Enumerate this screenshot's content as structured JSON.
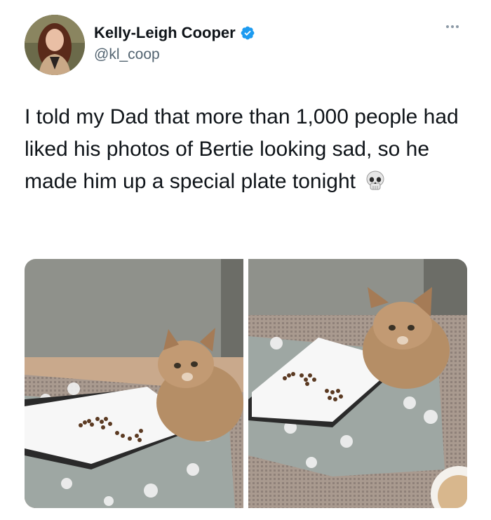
{
  "author": {
    "display_name": "Kelly-Leigh Cooper",
    "handle": "@kl_coop",
    "verified": true
  },
  "tweet": {
    "text": "I told my Dad that more than 1,000 people had liked his photos of Bertie looking sad, so he made him up a special plate tonight",
    "emoji": "💀"
  },
  "media": {
    "count": 2,
    "photos": [
      {
        "description_icon": "cat-photo-icon"
      },
      {
        "description_icon": "cat-photo-icon"
      }
    ]
  },
  "colors": {
    "text": "#0f1419",
    "secondary": "#536471",
    "verified": "#1d9bf0"
  }
}
